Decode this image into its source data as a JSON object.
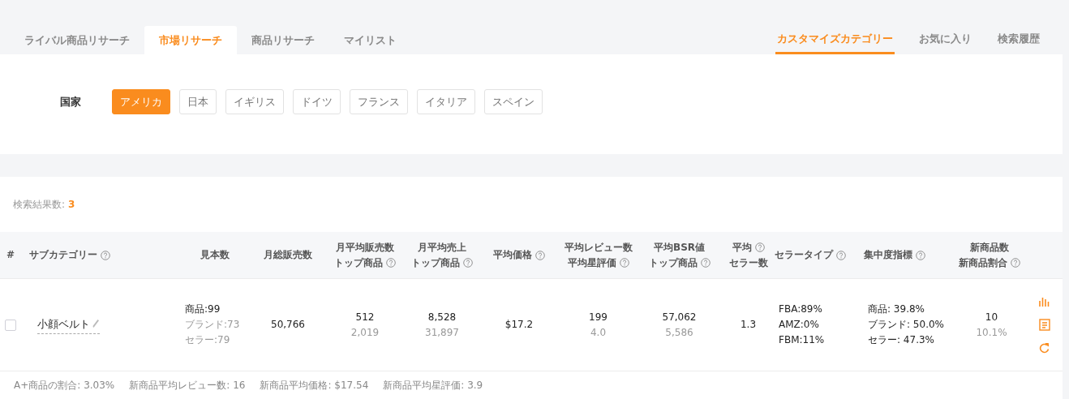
{
  "main_tabs": [
    {
      "label": "ライバル商品リサーチ",
      "selected": false
    },
    {
      "label": "市場リサーチ",
      "selected": true
    },
    {
      "label": "商品リサーチ",
      "selected": false
    },
    {
      "label": "マイリスト",
      "selected": false
    }
  ],
  "sub_tabs": [
    {
      "label": "カスタマイズカテゴリー",
      "selected": true
    },
    {
      "label": "お気に入り",
      "selected": false
    },
    {
      "label": "検索履歴",
      "selected": false
    }
  ],
  "country_filter": {
    "label": "国家",
    "options": [
      {
        "label": "アメリカ",
        "selected": true
      },
      {
        "label": "日本",
        "selected": false
      },
      {
        "label": "イギリス",
        "selected": false
      },
      {
        "label": "ドイツ",
        "selected": false
      },
      {
        "label": "フランス",
        "selected": false
      },
      {
        "label": "イタリア",
        "selected": false
      },
      {
        "label": "スペイン",
        "selected": false
      }
    ]
  },
  "results": {
    "label": "検索結果数:",
    "count": "3"
  },
  "table": {
    "columns": [
      {
        "lines": [
          {
            "text": "#",
            "help": false
          }
        ]
      },
      {
        "lines": [
          {
            "text": "サブカテゴリー",
            "help": true
          }
        ]
      },
      {
        "lines": [
          {
            "text": "見本数",
            "help": false
          }
        ]
      },
      {
        "lines": [
          {
            "text": "月総販売数",
            "help": false
          }
        ]
      },
      {
        "lines": [
          {
            "text": "月平均販売数",
            "help": false
          },
          {
            "text": "トップ商品",
            "help": true
          }
        ]
      },
      {
        "lines": [
          {
            "text": "月平均売上",
            "help": false
          },
          {
            "text": "トップ商品",
            "help": true
          }
        ]
      },
      {
        "lines": [
          {
            "text": "平均価格",
            "help": true
          }
        ]
      },
      {
        "lines": [
          {
            "text": "平均レビュー数",
            "help": false
          },
          {
            "text": "平均星評価",
            "help": true
          }
        ]
      },
      {
        "lines": [
          {
            "text": "平均BSR値",
            "help": false
          },
          {
            "text": "トップ商品",
            "help": true
          }
        ]
      },
      {
        "lines": [
          {
            "text": "平均",
            "help": true
          },
          {
            "text": "セラー数",
            "help": false
          }
        ]
      },
      {
        "lines": [
          {
            "text": "セラータイプ",
            "help": true
          }
        ]
      },
      {
        "lines": [
          {
            "text": "集中度指標",
            "help": true
          }
        ]
      },
      {
        "lines": [
          {
            "text": "新商品数",
            "help": false
          },
          {
            "text": "新商品割合",
            "help": true
          }
        ]
      }
    ],
    "rows": [
      {
        "cells": [
          {
            "kind": "checkbox",
            "checked": false
          },
          {
            "kind": "name",
            "text": "小顔ベルト"
          },
          {
            "kind": "lines",
            "lines": [
              {
                "text": "商品:99",
                "muted": false
              },
              {
                "text": "ブランド:73",
                "muted": true
              },
              {
                "text": "セラー:79",
                "muted": true
              }
            ]
          },
          {
            "kind": "lines",
            "lines": [
              {
                "text": "50,766",
                "muted": false
              }
            ]
          },
          {
            "kind": "lines",
            "lines": [
              {
                "text": "512",
                "muted": false
              },
              {
                "text": "2,019",
                "muted": true
              }
            ]
          },
          {
            "kind": "lines",
            "lines": [
              {
                "text": "8,528",
                "muted": false
              },
              {
                "text": "31,897",
                "muted": true
              }
            ]
          },
          {
            "kind": "lines",
            "lines": [
              {
                "text": "$17.2",
                "muted": false
              }
            ]
          },
          {
            "kind": "lines",
            "lines": [
              {
                "text": "199",
                "muted": false
              },
              {
                "text": "4.0",
                "muted": true
              }
            ]
          },
          {
            "kind": "lines",
            "lines": [
              {
                "text": "57,062",
                "muted": false
              },
              {
                "text": "5,586",
                "muted": true
              }
            ]
          },
          {
            "kind": "lines",
            "lines": [
              {
                "text": "1.3",
                "muted": false
              }
            ]
          },
          {
            "kind": "lines",
            "lines": [
              {
                "text": "FBA:89%",
                "muted": false
              },
              {
                "text": "AMZ:0%",
                "muted": false
              },
              {
                "text": "FBM:11%",
                "muted": false
              }
            ]
          },
          {
            "kind": "lines",
            "lines": [
              {
                "text": "商品: 39.8%",
                "muted": false
              },
              {
                "text": "ブランド: 50.0%",
                "muted": false
              },
              {
                "text": "セラー: 47.3%",
                "muted": false
              }
            ]
          },
          {
            "kind": "lines",
            "lines": [
              {
                "text": "10",
                "muted": false
              },
              {
                "text": "10.1%",
                "muted": true
              }
            ]
          }
        ],
        "summary": [
          {
            "label": "A+商品の割合:",
            "value": "3.03%"
          },
          {
            "label": "新商品平均レビュー数:",
            "value": "16"
          },
          {
            "label": "新商品平均価格:",
            "value": "$17.54"
          },
          {
            "label": "新商品平均星評価:",
            "value": "3.9"
          }
        ]
      }
    ]
  }
}
